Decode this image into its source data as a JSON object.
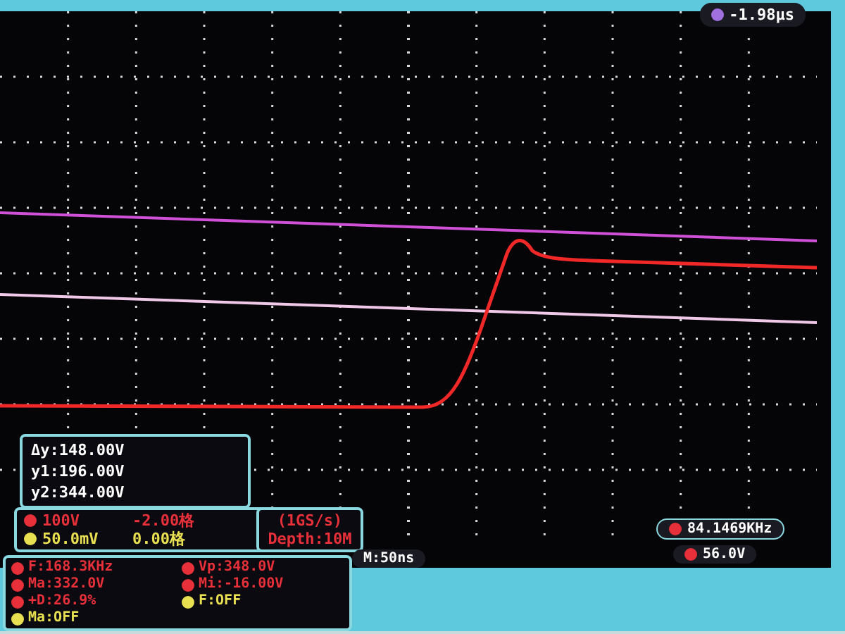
{
  "trigger_position": "-1.98μs",
  "cursor_readout": [
    "Δy:148.00V",
    "y1:196.00V",
    "y2:344.00V"
  ],
  "channels": [
    {
      "scale": "100V",
      "offset": "-2.00格",
      "color": "#e8303a"
    },
    {
      "scale": "50.0mV",
      "offset": "0.00格",
      "color": "#e8e050"
    }
  ],
  "acquisition": {
    "rate": "(1GS/s)",
    "depth": "Depth:10M"
  },
  "measurements": [
    {
      "text": "F:168.3KHz",
      "color": "#e8303a"
    },
    {
      "text": "Vp:348.0V",
      "color": "#e8303a"
    },
    {
      "text": "Ma:332.0V",
      "color": "#e8303a"
    },
    {
      "text": "Mi:-16.00V",
      "color": "#e8303a"
    },
    {
      "text": "+D:26.9%",
      "color": "#e8303a"
    },
    {
      "text": "F:OFF",
      "color": "#e8e050"
    },
    {
      "text": "Ma:OFF",
      "color": "#e8e050"
    }
  ],
  "timebase": "M:50ns",
  "frequency_counter": "84.1469KHz",
  "trigger_level": "56.0V"
}
